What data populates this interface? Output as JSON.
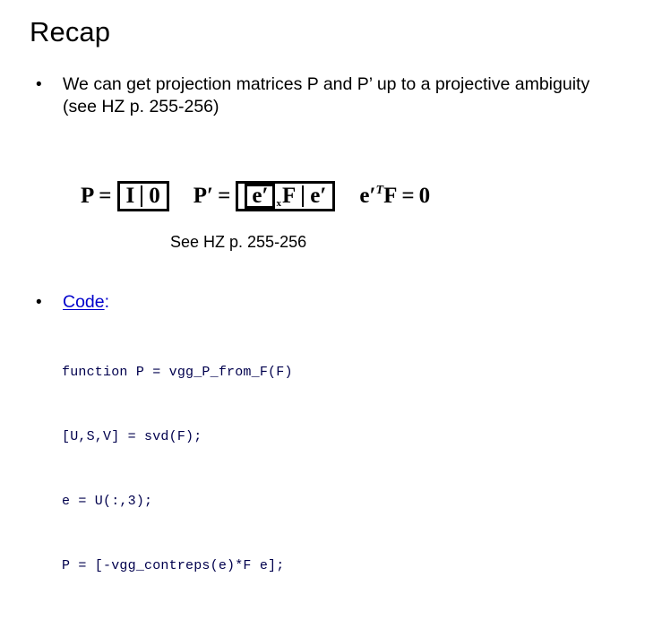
{
  "slide": {
    "title": "Recap",
    "background_color": "#ffffff",
    "text_color": "#000000"
  },
  "bullets": [
    {
      "marker": "•",
      "text": "We can get projection matrices P and P’ up to a projective ambiguity (see HZ p. 255-256)"
    },
    {
      "marker": "•",
      "link_label": "Code",
      "colon": ":",
      "link_color": "#0000cc"
    }
  ],
  "equation": {
    "eq1": {
      "lhs": "P",
      "equals": "=",
      "bracket_open": "[",
      "identity": "I",
      "separator": "|",
      "zero": "0",
      "bracket_close": "]",
      "plain": "P = [I | 0]"
    },
    "eq2": {
      "lhs": "P",
      "lhs_prime": "′",
      "equals": "=",
      "e_prime": "e",
      "prime": "′",
      "subscript": "x",
      "F": "F",
      "separator": "|",
      "e_prime2": "e",
      "prime2": "′",
      "plain": "P′ = [[e′]x F | e′]"
    },
    "eq3": {
      "e": "e",
      "prime": "′",
      "transpose": "T",
      "F": "F",
      "equals": "=",
      "zero": "0",
      "plain": "e′T F = 0"
    }
  },
  "caption": {
    "hz_reference": "See HZ p. 255-256"
  },
  "code": {
    "language": "matlab",
    "color": "#00004d",
    "lines": [
      "function P = vgg_P_from_F(F)",
      "[U,S,V] = svd(F);",
      "e = U(:,3);",
      "P = [-vgg_contreps(e)*F e];"
    ]
  }
}
